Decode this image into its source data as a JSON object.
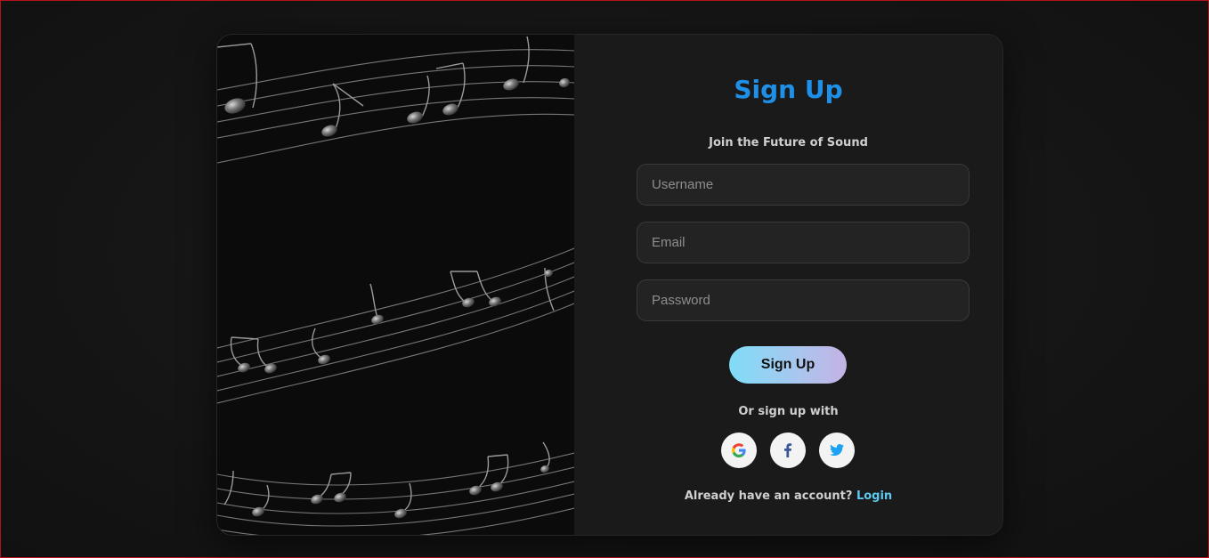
{
  "signup": {
    "title": "Sign Up",
    "subtitle": "Join the Future of Sound",
    "username_placeholder": "Username",
    "email_placeholder": "Email",
    "password_placeholder": "Password",
    "submit_label": "Sign Up",
    "social_prompt": "Or sign up with",
    "social": [
      {
        "name": "google",
        "icon": "google-icon",
        "color": "#db4437"
      },
      {
        "name": "facebook",
        "icon": "facebook-icon",
        "color": "#3b5998"
      },
      {
        "name": "twitter",
        "icon": "twitter-icon",
        "color": "#1da1f2"
      }
    ],
    "login_prompt": "Already have an account?",
    "login_label": "Login"
  },
  "colors": {
    "accent": "#1e90e8",
    "link": "#5fc8f0",
    "button_gradient_start": "#7fdcf7",
    "button_gradient_end": "#c4b2e3",
    "panel_background": "#1a1a1a",
    "page_background": "#151515"
  }
}
